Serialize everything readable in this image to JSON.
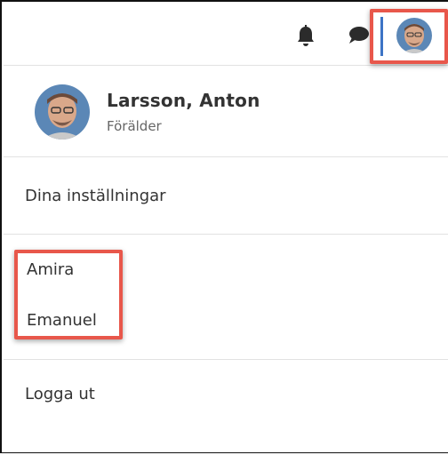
{
  "header": {
    "icons": [
      "bell-icon",
      "chat-icon",
      "avatar"
    ]
  },
  "profile": {
    "name": "Larsson, Anton",
    "role": "Förälder"
  },
  "menu": {
    "settings_label": "Dina inställningar",
    "children": [
      {
        "label": "Amira"
      },
      {
        "label": "Emanuel"
      }
    ],
    "logout_label": "Logga ut"
  },
  "colors": {
    "highlight": "#e8574b",
    "accent": "#3d74c5",
    "divider": "#e2e2e2"
  }
}
